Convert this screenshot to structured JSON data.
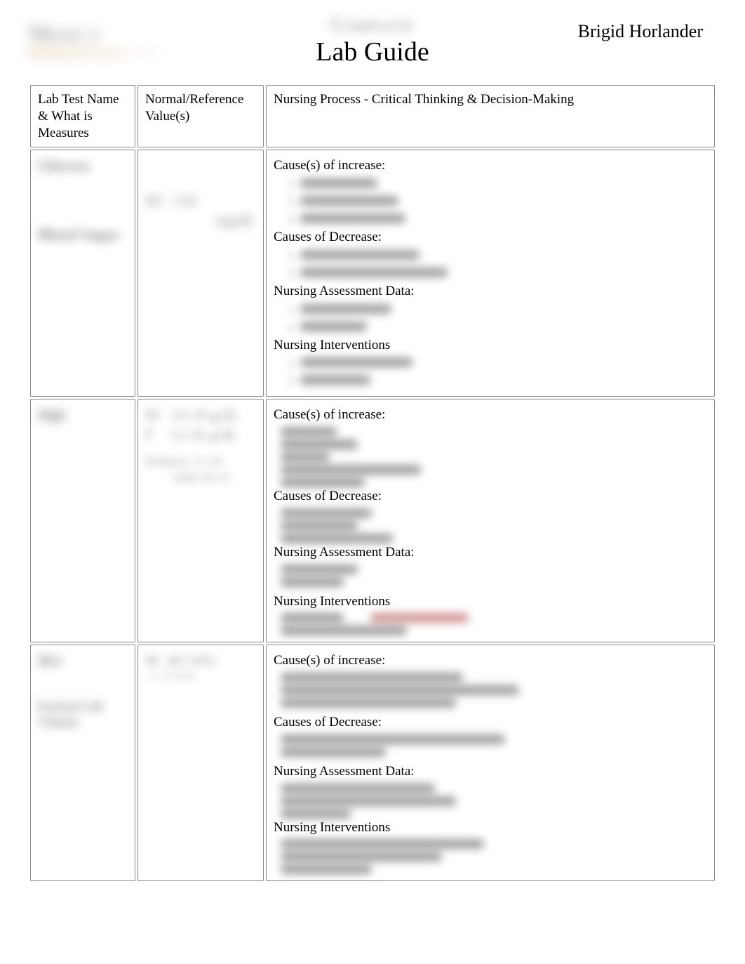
{
  "header": {
    "author": "Brigid Horlander",
    "title": "Lab Guide"
  },
  "columns": {
    "c1": "Lab Test Name & What is Measures",
    "c2": "Normal/Reference Value(s)",
    "c3": "Nursing Process - Critical Thinking & Decision-Making"
  },
  "sections": {
    "increase": "Cause(s) of increase:",
    "decrease": "Causes of Decrease:",
    "assessment": "Nursing Assessment Data:",
    "interventions": "Nursing Interventions"
  }
}
